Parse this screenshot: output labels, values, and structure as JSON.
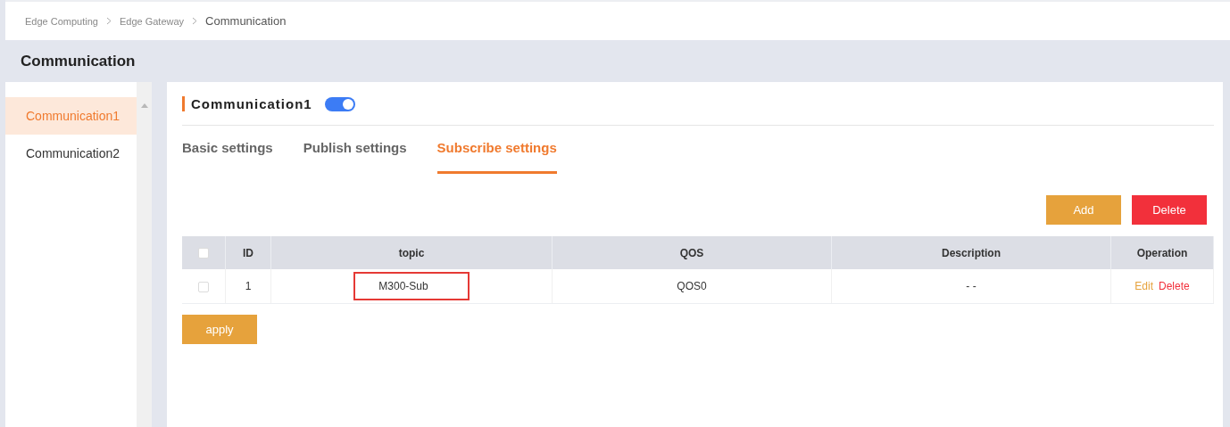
{
  "breadcrumb": [
    {
      "label": "Edge Computing",
      "current": false
    },
    {
      "label": "Edge Gateway",
      "current": false
    },
    {
      "label": "Communication",
      "current": true
    }
  ],
  "page_title": "Communication",
  "sidebar": {
    "items": [
      {
        "label": "Communication1",
        "selected": true
      },
      {
        "label": "Communication2",
        "selected": false
      }
    ]
  },
  "panel": {
    "title": "Communication1",
    "enabled": true
  },
  "tabs": [
    {
      "label": "Basic settings",
      "selected": false
    },
    {
      "label": "Publish settings",
      "selected": false
    },
    {
      "label": "Subscribe settings",
      "selected": true
    }
  ],
  "toolbar": [
    {
      "label": "Add",
      "kind": "add"
    },
    {
      "label": "Delete",
      "kind": "delete"
    }
  ],
  "table": {
    "columns": [
      "ID",
      "topic",
      "QOS",
      "Description",
      "Operation"
    ],
    "header_checked": false,
    "rows": [
      {
        "checked": false,
        "id": "1",
        "topic": "M300-Sub",
        "topic_highlighted": true,
        "qos": "QOS0",
        "description": "- -",
        "actions": [
          {
            "label": "Edit",
            "kind": "edit"
          },
          {
            "label": "Delete",
            "kind": "delete"
          }
        ]
      }
    ]
  },
  "apply_button": "apply"
}
